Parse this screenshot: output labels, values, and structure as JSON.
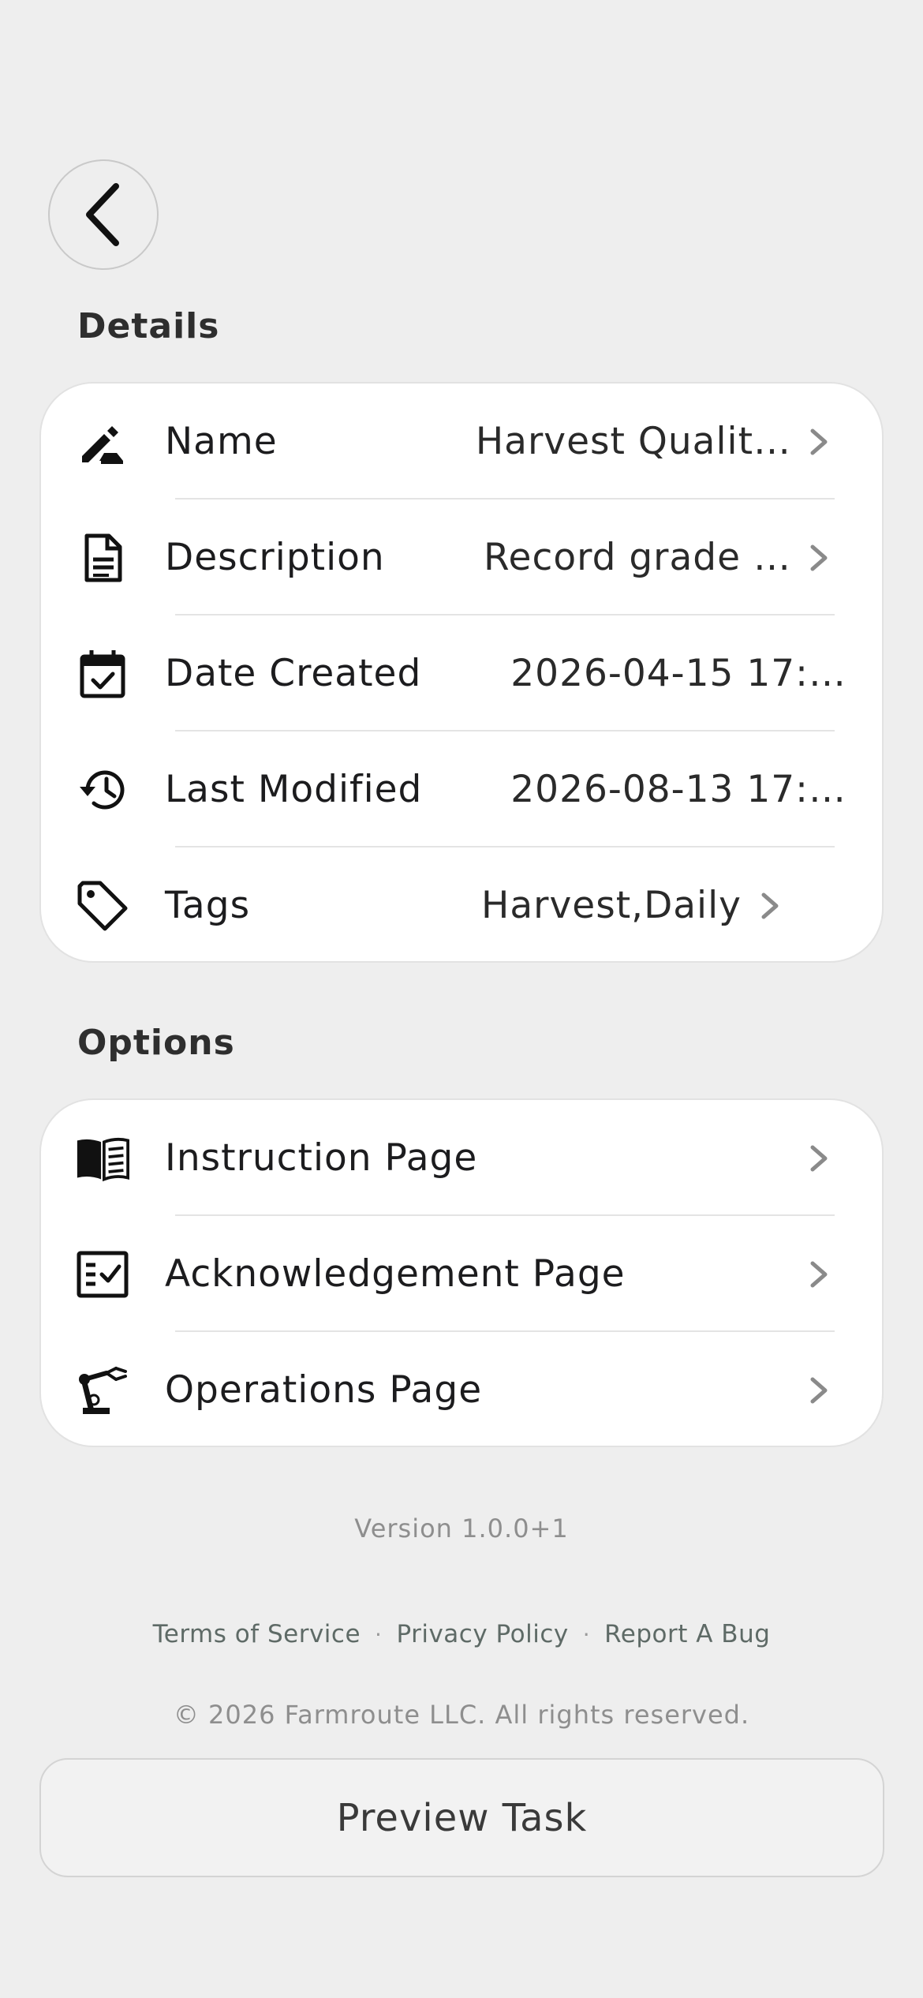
{
  "header": {
    "back_icon": "chevron-left-icon"
  },
  "details": {
    "title": "Details",
    "rows": [
      {
        "icon": "edit-pencil-icon",
        "label": "Name",
        "value": "Harvest Qualit…",
        "chevron": true
      },
      {
        "icon": "document-icon",
        "label": "Description",
        "value": "Record grade …",
        "chevron": true
      },
      {
        "icon": "calendar-check-icon",
        "label": "Date Created",
        "value": "2026-04-15 17:…",
        "chevron": false
      },
      {
        "icon": "history-icon",
        "label": "Last Modified",
        "value": "2026-08-13 17:…",
        "chevron": false
      },
      {
        "icon": "tag-icon",
        "label": "Tags",
        "value": "Harvest,Daily",
        "chevron": true
      }
    ]
  },
  "options": {
    "title": "Options",
    "rows": [
      {
        "icon": "open-book-icon",
        "label": "Instruction Page"
      },
      {
        "icon": "checklist-icon",
        "label": "Acknowledgement Page"
      },
      {
        "icon": "robot-arm-icon",
        "label": "Operations Page"
      }
    ]
  },
  "footer": {
    "version": "Version 1.0.0+1",
    "links": [
      "Terms of Service",
      "Privacy Policy",
      "Report A Bug"
    ],
    "separator": "·",
    "copyright": "© 2026 Farmroute LLC. All rights reserved."
  },
  "preview_button": "Preview Task"
}
